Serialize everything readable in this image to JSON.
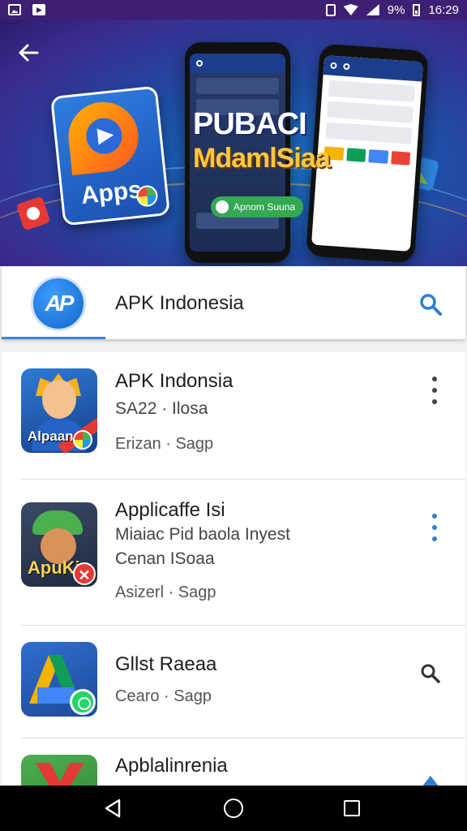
{
  "status_bar": {
    "battery": "9%",
    "time": "16:29",
    "icons": [
      "photo-icon",
      "flag-icon",
      "vibrate-icon",
      "wifi-icon",
      "signal-icon",
      "battery-icon"
    ]
  },
  "hero": {
    "title": "PUBACI",
    "subtitle": "MdamlSiaa",
    "apps_label": "Apps",
    "pill_label": "Apnom Suuna",
    "icons": [
      "back-arrow-icon"
    ]
  },
  "search": {
    "brand_logo_text": "AP",
    "query": "APK Indonesia",
    "icon": "search-icon"
  },
  "apps": [
    {
      "title": "APK Indonsia",
      "line1": "SA22 · Ilosa",
      "meta": "Erizan · Sagp",
      "icon_label": "Alpaan",
      "action": "more-vert-icon"
    },
    {
      "title": "Applicaffe Isi",
      "line1": "Miaiac Pid baola Inyest",
      "line2": "Cenan ISoaa",
      "meta": "Asizerl · Sagp",
      "icon_label": "ApuKi",
      "action": "more-vert-icon"
    },
    {
      "title": "Gllst Raeaa",
      "meta": "Cearo  · Sagp",
      "action": "search-icon"
    },
    {
      "title": "Apblalinrenia",
      "action": "arrow-up-icon"
    }
  ],
  "colors": {
    "status_bar": "#3d1f74",
    "accent": "#2f7fd0",
    "hero_title": "#ffffff",
    "hero_subtitle": "#ffc83d"
  },
  "nav_bar": {
    "icons": [
      "back-triangle-icon",
      "home-circle-icon",
      "recents-square-icon"
    ]
  }
}
